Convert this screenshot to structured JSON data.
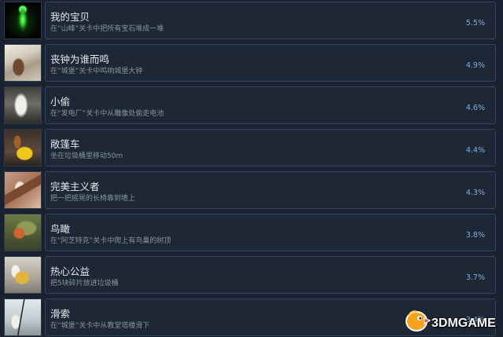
{
  "colors": {
    "page_background": "#1a2130",
    "panel_background": "#1e2735",
    "panel_border": "#34475c",
    "title_text": "#e4e8ec",
    "description_text": "#85939f",
    "percent_text": "#7fb0d8"
  },
  "achievements": [
    {
      "title": "我的宝贝",
      "description": "在“山峰”关卡中把所有宝石堆成一堆",
      "percent": "5.5%"
    },
    {
      "title": "丧钟为谁而鸣",
      "description": "在“城堡”关卡中鸣响城堡大钟",
      "percent": "4.9%"
    },
    {
      "title": "小偷",
      "description": "在“发电厂”关卡中从雕像处偷走电池",
      "percent": "4.6%"
    },
    {
      "title": "敞篷车",
      "description": "坐在垃圾桶里移动50m",
      "percent": "4.4%"
    },
    {
      "title": "完美主义者",
      "description": "把一把摇晃的长椅靠到墙上",
      "percent": "4.3%"
    },
    {
      "title": "鸟瞰",
      "description": "在“阿芝特克”关卡中爬上有鸟巢的树顶",
      "percent": "3.8%"
    },
    {
      "title": "热心公益",
      "description": "把5块碎片放进垃圾桶",
      "percent": "3.7%"
    },
    {
      "title": "滑索",
      "description": "在“城堡”关卡中从教堂塔楼滑下",
      "percent": "3.4%"
    }
  ],
  "watermark": {
    "text": "3DMGAME",
    "icon": "3dm-bird-logo-icon"
  }
}
